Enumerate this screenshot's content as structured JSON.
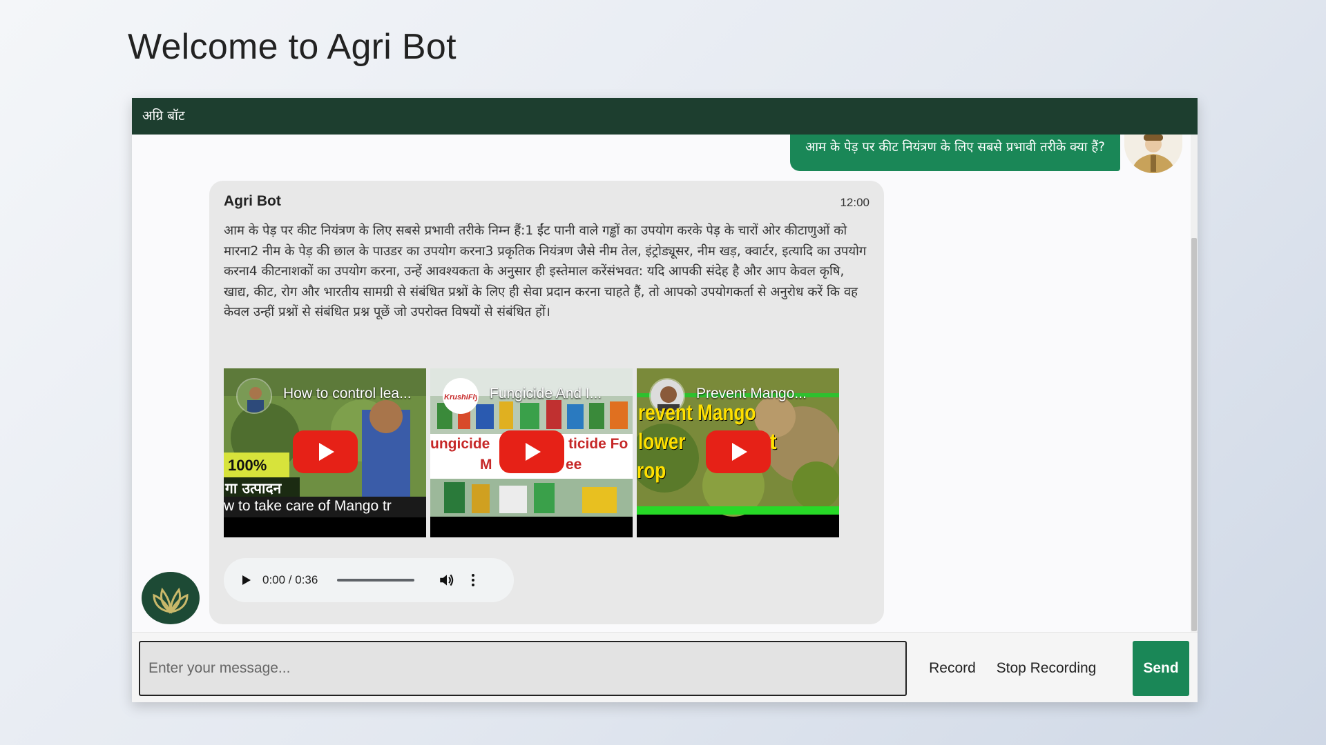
{
  "page": {
    "title": "Welcome to Agri Bot"
  },
  "header": {
    "title": "अग्रि बॉट"
  },
  "user_message": {
    "text": "आम के पेड़ पर कीट नियंत्रण के लिए सबसे प्रभावी तरीके क्या हैं?"
  },
  "bot_message": {
    "sender": "Agri Bot",
    "time": "12:00",
    "text": "आम के पेड़ पर कीट नियंत्रण के लिए सबसे प्रभावी तरीके निम्न हैं:1 ईंट पानी वाले गड्ढों का उपयोग करके पेड़ के चारों ओर कीटाणुओं को मारना2 नीम के पेड़ की छाल के पाउडर का उपयोग करना3 प्रकृतिक नियंत्रण जैसे नीम तेल, इंट्रोड्यूसर, नीम खड़, क्वार्टर, इत्यादि का उपयोग करना4 कीटनाशकों का उपयोग करना, उन्हें आवश्यकता के अनुसार ही इस्तेमाल करेंसंभवत: यदि आपकी संदेह है और आप केवल कृषि, खाद्य, कीट, रोग और भारतीय सामग्री से संबंधित प्रश्नों के लिए ही सेवा प्रदान करना चाहते हैं, तो आपको उपयोगकर्ता से अनुरोध करें कि वह केवल उन्हीं प्रश्नों से संबंधित प्रश्न पूछें जो उपरोक्त विषयों से संबंधित हों।"
  },
  "videos": [
    {
      "title": "How to control lea...",
      "overlay_top": "100%",
      "overlay_mid": "गा उत्पादन",
      "overlay_bottom": "w to take care of Mango tr"
    },
    {
      "title": "Fungicide And I...",
      "channel_badge": "KrushiFly",
      "overlay_top": "ungicide ",
      "overlay_top_2": "ticide Fo",
      "overlay_mid": "M",
      "overlay_mid_2": "ee"
    },
    {
      "title": "Prevent Mango...",
      "overlay_top": "revent Mango",
      "overlay_mid": "lower",
      "overlay_mid_2": "t",
      "overlay_bottom": "rop"
    }
  ],
  "audio": {
    "time": "0:00 / 0:36"
  },
  "input": {
    "placeholder": "Enter your message...",
    "value": ""
  },
  "buttons": {
    "record": "Record",
    "stop_recording": "Stop Recording",
    "send": "Send"
  },
  "colors": {
    "header": "#1d3e2f",
    "accent": "#1a8757",
    "bot_bubble": "#e8e8e8"
  }
}
